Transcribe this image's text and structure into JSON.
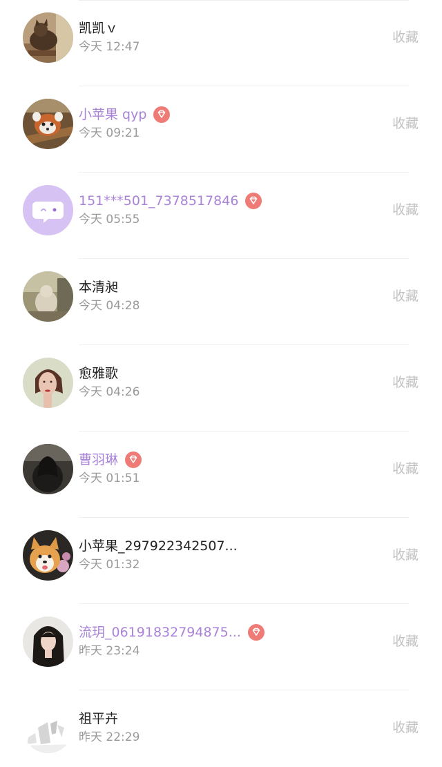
{
  "fav_label": "收藏",
  "colors": {
    "vip_name": "#a983d8",
    "vip_badge": "#ee7b75",
    "normal_name": "#222222",
    "time": "#9a9a9a",
    "fav": "#c2c2c2"
  },
  "users": [
    {
      "name": "凯凯ｖ",
      "time": "今天 12:47",
      "vip": false,
      "avatar": "cat-photo"
    },
    {
      "name": "小苹果 qyp",
      "time": "今天 09:21",
      "vip": true,
      "avatar": "red-panda-photo"
    },
    {
      "name": "151***501_7378517846",
      "time": "今天 05:55",
      "vip": true,
      "avatar": "default-chat-bubble"
    },
    {
      "name": "本清昶",
      "time": "今天 04:28",
      "vip": false,
      "avatar": "room-cat-photo"
    },
    {
      "name": "愈雅歌",
      "time": "今天 04:26",
      "vip": false,
      "avatar": "woman-portrait"
    },
    {
      "name": "曹羽琳",
      "time": "今天 01:51",
      "vip": true,
      "avatar": "woman-dark-portrait"
    },
    {
      "name": "小苹果_297922342507...",
      "time": "今天 01:32",
      "vip": false,
      "avatar": "corgi-photo"
    },
    {
      "name": "流玥_06191832794875...",
      "time": "昨天 23:24",
      "vip": true,
      "avatar": "woman-selfie"
    },
    {
      "name": "祖平卉",
      "time": "昨天 22:29",
      "vip": false,
      "avatar": "sketch-photo"
    }
  ]
}
